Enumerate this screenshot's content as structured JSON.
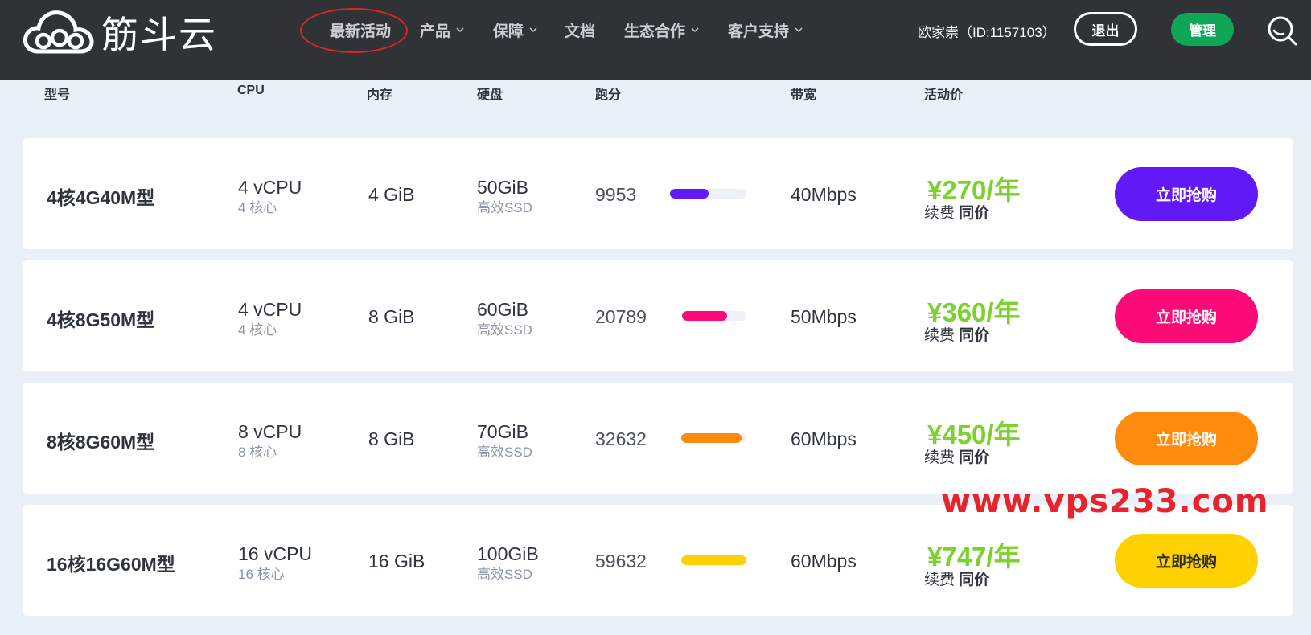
{
  "brand": {
    "name": "筋斗云"
  },
  "nav": {
    "items": [
      {
        "label": "最新活动",
        "has_caret": false
      },
      {
        "label": "产品",
        "has_caret": true
      },
      {
        "label": "保障",
        "has_caret": true
      },
      {
        "label": "文档",
        "has_caret": false
      },
      {
        "label": "生态合作",
        "has_caret": true
      },
      {
        "label": "客户支持",
        "has_caret": true
      }
    ]
  },
  "user": {
    "label": "欧家崇（ID:1157103）"
  },
  "actions": {
    "logout_label": "退出",
    "manage_label": "管理"
  },
  "table": {
    "headers": [
      "型号",
      "CPU",
      "内存",
      "硬盘",
      "跑分",
      "带宽",
      "活动价"
    ],
    "rows": [
      {
        "model": "4核4G40M型",
        "cpu": "4 vCPU",
        "cpu_sub": "4 核心",
        "memory": "4 GiB",
        "disk": "50GiB",
        "disk_sub": "高效SSD",
        "score": "9953",
        "score_fraction": 0.5,
        "bandwidth": "40Mbps",
        "price": "¥270/年",
        "renew_label": "续费",
        "renew_value": "同价",
        "buy_label": "立即抢购",
        "color": "#6119f5"
      },
      {
        "model": "4核8G50M型",
        "cpu": "4 vCPU",
        "cpu_sub": "4 核心",
        "memory": "8 GiB",
        "disk": "60GiB",
        "disk_sub": "高效SSD",
        "score": "20789",
        "score_fraction": 0.7,
        "bandwidth": "50Mbps",
        "price": "¥360/年",
        "renew_label": "续费",
        "renew_value": "同价",
        "buy_label": "立即抢购",
        "color": "#fb0a78"
      },
      {
        "model": "8核8G60M型",
        "cpu": "8 vCPU",
        "cpu_sub": "8 核心",
        "memory": "8 GiB",
        "disk": "70GiB",
        "disk_sub": "高效SSD",
        "score": "32632",
        "score_fraction": 0.92,
        "bandwidth": "60Mbps",
        "price": "¥450/年",
        "renew_label": "续费",
        "renew_value": "同价",
        "buy_label": "立即抢购",
        "color": "#fe8b0e"
      },
      {
        "model": "16核16G60M型",
        "cpu": "16 vCPU",
        "cpu_sub": "16 核心",
        "memory": "16 GiB",
        "disk": "100GiB",
        "disk_sub": "高效SSD",
        "score": "59632",
        "score_fraction": 1.0,
        "bandwidth": "60Mbps",
        "price": "¥747/年",
        "renew_label": "续费",
        "renew_value": "同价",
        "buy_label": "立即抢购",
        "color": "#ffd100",
        "buy_text_color": "#2b2b2b"
      }
    ]
  },
  "watermark": "www.vps233.com",
  "colors": {
    "header_bg": "#2f3336",
    "page_bg": "#e9f0f8",
    "price_green": "#7bd22f",
    "manage_green": "#0fa657",
    "highlight_red": "#e0232b"
  }
}
